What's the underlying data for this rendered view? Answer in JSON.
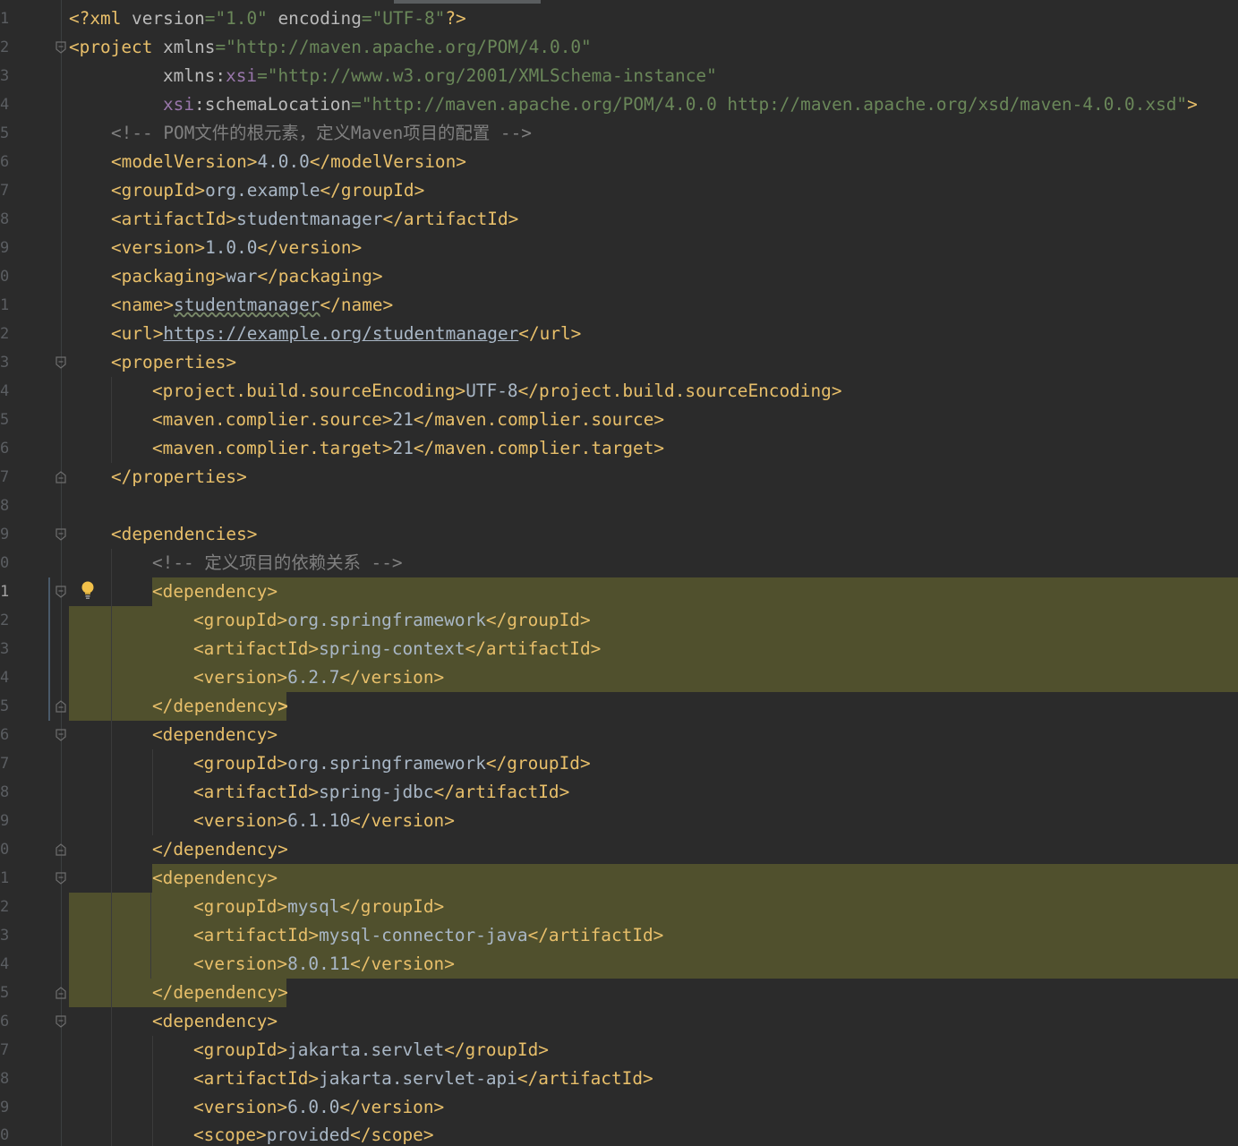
{
  "editor": {
    "line_numbers": [
      "1",
      "2",
      "3",
      "4",
      "5",
      "6",
      "7",
      "8",
      "9",
      "0",
      "1",
      "2",
      "3",
      "4",
      "5",
      "6",
      "7",
      "8",
      "9",
      "0",
      "1",
      "2",
      "3",
      "4",
      "5",
      "6",
      "7",
      "8",
      "9",
      "0",
      "1",
      "2",
      "3",
      "4",
      "5",
      "6",
      "7",
      "8",
      "9",
      "0"
    ],
    "current_line_label": "1",
    "lines": {
      "l1_a": "<?xml ",
      "l1_b": "version",
      "l1_c": "=\"1.0\"",
      "l1_d": " encoding",
      "l1_e": "=\"UTF-8\"",
      "l1_f": "?>",
      "l2_a": "<project ",
      "l2_b": "xmlns",
      "l2_c": "=\"http://maven.apache.org/POM/4.0.0\"",
      "l3_a": "xmlns",
      "l3_b": ":",
      "l3_c": "xsi",
      "l3_d": "=\"http://www.w3.org/2001/XMLSchema-instance\"",
      "l4_a": "xsi",
      "l4_b": ":schemaLocation",
      "l4_c": "=\"http://maven.apache.org/POM/4.0.0 http://maven.apache.org/xsd/maven-4.0.0.xsd\"",
      "l4_d": ">",
      "l5": "<!-- POM文件的根元素，定义Maven项目的配置 -->",
      "l6_a": "<modelVersion>",
      "l6_b": "4.0.0",
      "l6_c": "</modelVersion>",
      "l7_a": "<groupId>",
      "l7_b": "org.example",
      "l7_c": "</groupId>",
      "l8_a": "<artifactId>",
      "l8_b": "studentmanager",
      "l8_c": "</artifactId>",
      "l9_a": "<version>",
      "l9_b": "1.0.0",
      "l9_c": "</version>",
      "l10_a": "<packaging>",
      "l10_b": "war",
      "l10_c": "</packaging>",
      "l11_a": "<name>",
      "l11_b": "studentmanager",
      "l11_c": "</name>",
      "l12_a": "<url>",
      "l12_b": "https://example.org/studentmanager",
      "l12_c": "</url>",
      "l13": "<properties>",
      "l14_a": "<project.build.sourceEncoding>",
      "l14_b": "UTF-8",
      "l14_c": "</project.build.sourceEncoding>",
      "l15_a": "<maven.complier.source>",
      "l15_b": "21",
      "l15_c": "</maven.complier.source>",
      "l16_a": "<maven.complier.target>",
      "l16_b": "21",
      "l16_c": "</maven.complier.target>",
      "l17": "</properties>",
      "l19": "<dependencies>",
      "l20": "<!-- 定义项目的依赖关系 -->",
      "l21_a": "<dependency",
      "l21_b": ">",
      "l22_a": "<groupId>",
      "l22_b": "org.springframework",
      "l22_c": "</groupId>",
      "l23_a": "<artifactId>",
      "l23_b": "spring-context",
      "l23_c": "</artifactId>",
      "l24_a": "<version>",
      "l24_b": "6.2.7",
      "l24_c": "</version>",
      "l25_a": "</dependency",
      "l25_b": ">",
      "l26": "<dependency>",
      "l27_a": "<groupId>",
      "l27_b": "org.springframework",
      "l27_c": "</groupId>",
      "l28_a": "<artifactId>",
      "l28_b": "spring-jdbc",
      "l28_c": "</artifactId>",
      "l29_a": "<version>",
      "l29_b": "6.1.10",
      "l29_c": "</version>",
      "l30": "</dependency>",
      "l31": "<dependency>",
      "l32_a": "<groupId>",
      "l32_b": "mysql",
      "l32_c": "</groupId>",
      "l33_a": "<artifactId>",
      "l33_b": "mysql-connector-java",
      "l33_c": "</artifactId>",
      "l34_a": "<version>",
      "l34_b": "8.0.11",
      "l34_c": "</version>",
      "l35": "</dependency>",
      "l36": "<dependency>",
      "l37_a": "<groupId>",
      "l37_b": "jakarta.servlet",
      "l37_c": "</groupId>",
      "l38_a": "<artifactId>",
      "l38_b": "jakarta.servlet-api",
      "l38_c": "</artifactId>",
      "l39_a": "<version>",
      "l39_b": "6.0.0",
      "l39_c": "</version>",
      "l40_a": "<scope>",
      "l40_b": "provided",
      "l40_c": "</scope>"
    }
  },
  "colors": {
    "background": "#2b2b2b",
    "tag": "#e8bf6a",
    "attribute": "#bababa",
    "namespace": "#9876aa",
    "attribute_value": "#6a8759",
    "comment": "#808080",
    "text": "#a9b7c6",
    "highlight": "#50502d"
  },
  "icons": [
    "fold-marker-icon",
    "intention-bulb-icon"
  ]
}
